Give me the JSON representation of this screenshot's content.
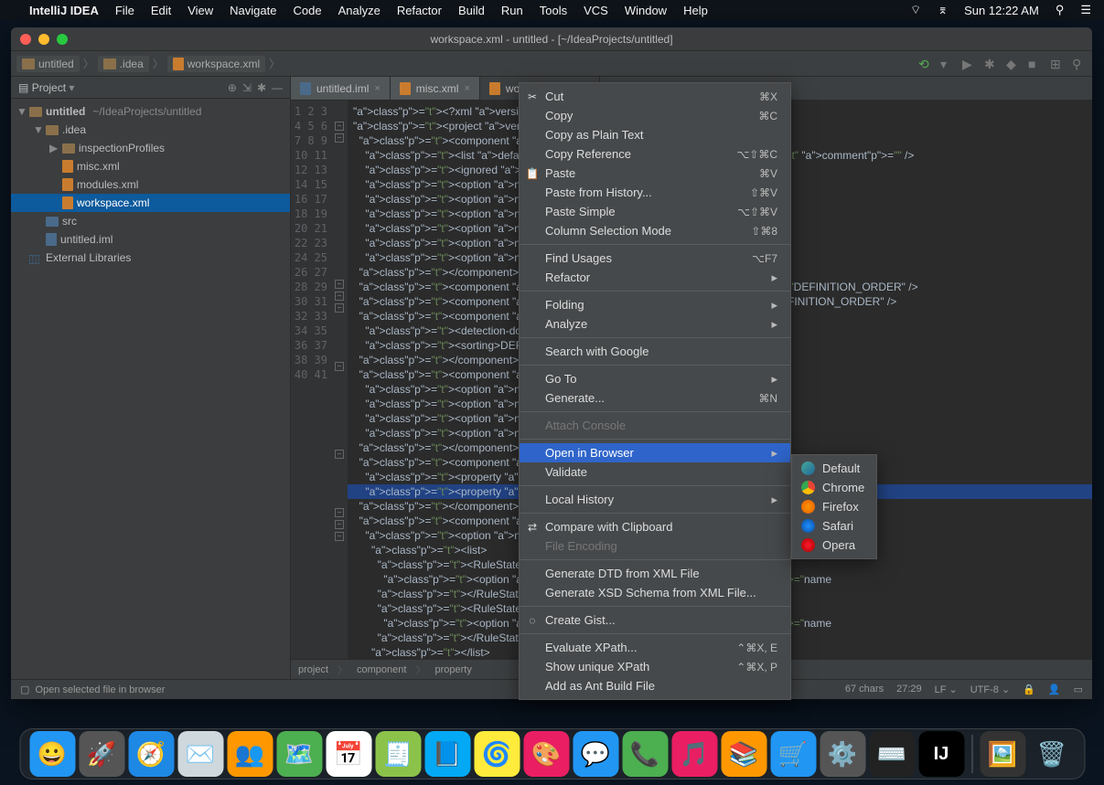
{
  "menubar": {
    "app": "IntelliJ IDEA",
    "items": [
      "File",
      "Edit",
      "View",
      "Navigate",
      "Code",
      "Analyze",
      "Refactor",
      "Build",
      "Run",
      "Tools",
      "VCS",
      "Window",
      "Help"
    ],
    "clock": "Sun 12:22 AM"
  },
  "window": {
    "title": "workspace.xml - untitled - [~/IdeaProjects/untitled]"
  },
  "breadcrumb": {
    "a": "untitled",
    "b": ".idea",
    "c": "workspace.xml"
  },
  "tool_window": {
    "title": "Project"
  },
  "tree": {
    "root": "untitled",
    "root_path": "~/IdeaProjects/untitled",
    "idea": ".idea",
    "ins": "inspectionProfiles",
    "misc": "misc.xml",
    "modules": "modules.xml",
    "workspace": "workspace.xml",
    "src": "src",
    "untitled_iml": "untitled.iml",
    "ext": "External Libraries"
  },
  "tabs": {
    "t1": "untitled.iml",
    "t2": "misc.xml",
    "t3": "workspace.xml"
  },
  "code_lines": [
    "<?xml version=\"1.0\" encoding=",
    "<project version=\"4\">",
    "  <component name=\"ChangeLis",
    "    <list default=\"true\" id=                                   =\"Default\" comment=\"\" />",
    "    <ignored path=\"$PROJECT_",
    "    <option name=\"EXCLUDED_C",
    "    <option name=\"TRACKING_E",
    "    <option name=\"SHOW_DIALO",
    "    <option name=\"HIGHLIGHT_",
    "    <option name=\"HIGHLIGHT_",
    "    <option name=\"LAST_RESOL",
    "  </component>",
    "  <component name=\"JsBuildTo                                orting=\"DEFINITION_ORDER\" />",
    "  <component name=\"JsBuildTo                                g=\"DEFINITION_ORDER\" />",
    "  <component name=\"JsGulpfil",
    "    <detection-done>true</de",
    "    <sorting>DEFINITION_ORDE",
    "  </component>",
    "  <component name=\"ProjectFr",
    "    <option name=\"x\" value=\"",
    "    <option name=\"y\" value=\"",
    "    <option name=\"width\" val",
    "    <option name=\"height\" va",
    "  </component>",
    "  <component name=\"Propertie",
    "    <property name=\"WebServe",
    "    <property name=\"aspect.p",
    "  </component>",
    "  <component name=\"RunDashbo",
    "    <option name=\"ruleStates",
    "      <list>",
    "        <RuleState>",
    "          <option name=\"name                               option name=\"name",
    "        </RuleState>",
    "        <RuleState>",
    "          <option name=\"name                               option name=\"name",
    "        </RuleState>",
    "      </list>",
    "    </option>",
    "  </component>",
    ""
  ],
  "line_start": 1,
  "line_end": 41,
  "editor_bc": {
    "a": "project",
    "b": "component",
    "c": "property"
  },
  "status": {
    "hint": "Open selected file in browser",
    "chars": "67 chars",
    "pos": "27:29",
    "sep": "LF",
    "enc": "UTF-8"
  },
  "context_menu": [
    {
      "label": "Cut",
      "short": "⌘X",
      "icon": "✂"
    },
    {
      "label": "Copy",
      "short": "⌘C"
    },
    {
      "label": "Copy as Plain Text"
    },
    {
      "label": "Copy Reference",
      "short": "⌥⇧⌘C"
    },
    {
      "label": "Paste",
      "short": "⌘V",
      "icon": "📋"
    },
    {
      "label": "Paste from History...",
      "short": "⇧⌘V"
    },
    {
      "label": "Paste Simple",
      "short": "⌥⇧⌘V"
    },
    {
      "label": "Column Selection Mode",
      "short": "⇧⌘8"
    },
    {
      "sep": true
    },
    {
      "label": "Find Usages",
      "short": "⌥F7"
    },
    {
      "label": "Refactor",
      "sub": true
    },
    {
      "sep": true
    },
    {
      "label": "Folding",
      "sub": true
    },
    {
      "label": "Analyze",
      "sub": true
    },
    {
      "sep": true
    },
    {
      "label": "Search with Google"
    },
    {
      "sep": true
    },
    {
      "label": "Go To",
      "sub": true
    },
    {
      "label": "Generate...",
      "short": "⌘N"
    },
    {
      "sep": true
    },
    {
      "label": "Attach Console",
      "disabled": true
    },
    {
      "sep": true
    },
    {
      "label": "Open in Browser",
      "sub": true,
      "sel": true
    },
    {
      "label": "Validate"
    },
    {
      "sep": true
    },
    {
      "label": "Local History",
      "sub": true
    },
    {
      "sep": true
    },
    {
      "label": "Compare with Clipboard",
      "icon": "⇄"
    },
    {
      "label": "File Encoding",
      "disabled": true
    },
    {
      "sep": true
    },
    {
      "label": "Generate DTD from XML File"
    },
    {
      "label": "Generate XSD Schema from XML File..."
    },
    {
      "sep": true
    },
    {
      "label": "Create Gist...",
      "icon": "◌"
    },
    {
      "sep": true
    },
    {
      "label": "Evaluate XPath...",
      "short": "⌃⌘X, E"
    },
    {
      "label": "Show unique XPath",
      "short": "⌃⌘X, P"
    },
    {
      "label": "Add as Ant Build File"
    }
  ],
  "submenu": [
    {
      "label": "Default",
      "icon": "i-default"
    },
    {
      "label": "Chrome",
      "icon": "i-chrome"
    },
    {
      "label": "Firefox",
      "icon": "i-firefox"
    },
    {
      "label": "Safari",
      "icon": "i-safari"
    },
    {
      "label": "Opera",
      "icon": "i-opera"
    }
  ],
  "dock": [
    "😀",
    "🚀",
    "🧭",
    "✉️",
    "👥",
    "🗺️",
    "📅",
    "🧾",
    "📘",
    "🌀",
    "🎨",
    "💬",
    "📞",
    "🎵",
    "📚",
    "🛒",
    "⚙️",
    "⌨️",
    "IJ"
  ]
}
